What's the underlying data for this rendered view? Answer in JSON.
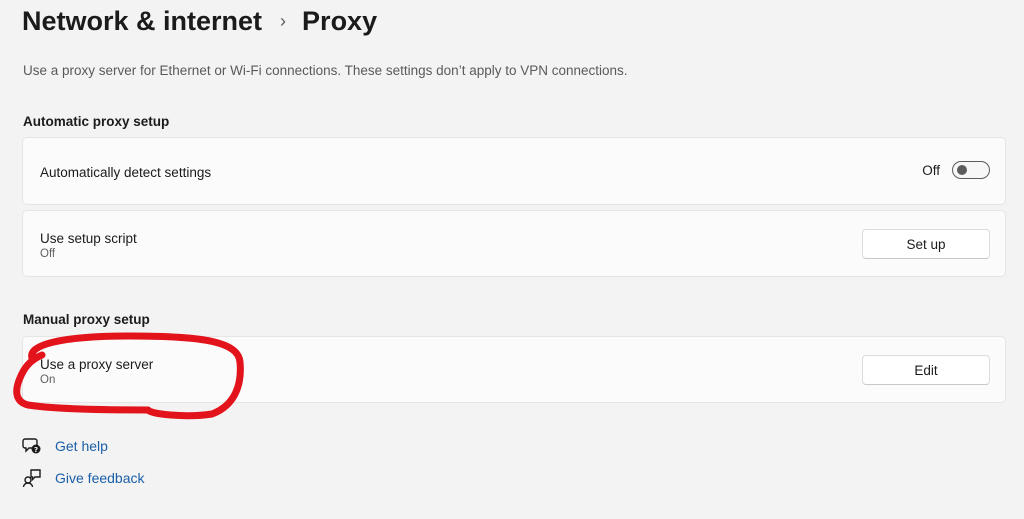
{
  "header": {
    "parent": "Network & internet",
    "current": "Proxy"
  },
  "description": "Use a proxy server for Ethernet or Wi-Fi connections. These settings don’t apply to VPN connections.",
  "automatic": {
    "section_title": "Automatic proxy setup",
    "detect": {
      "title": "Automatically detect settings",
      "toggle_label": "Off",
      "toggle_on": false
    },
    "script": {
      "title": "Use setup script",
      "status": "Off",
      "button_label": "Set up"
    }
  },
  "manual": {
    "section_title": "Manual proxy setup",
    "proxy": {
      "title": "Use a proxy server",
      "status": "On",
      "button_label": "Edit"
    }
  },
  "links": {
    "help": "Get help",
    "feedback": "Give feedback"
  },
  "colors": {
    "background": "#f3f3f3",
    "card": "#fbfbfb",
    "link": "#1b5fa8",
    "annotation": "#e3131b"
  },
  "icons": {
    "breadcrumb_separator": "chevron-right-icon",
    "help": "help-chat-icon",
    "feedback": "feedback-icon"
  }
}
